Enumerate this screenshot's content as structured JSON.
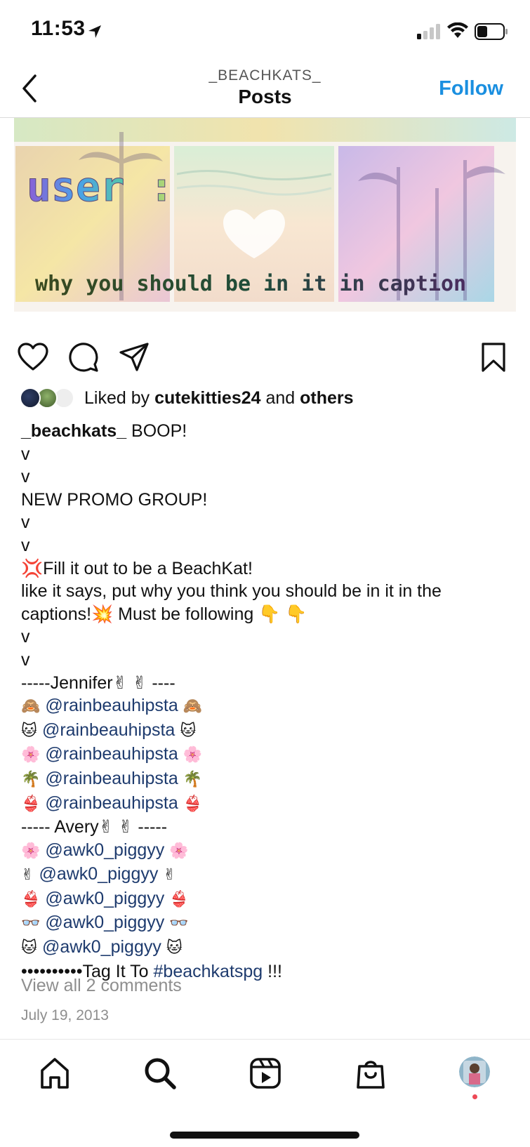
{
  "status_bar": {
    "time": "11:53"
  },
  "header": {
    "username": "_BEACHKATS_",
    "title": "Posts",
    "follow_label": "Follow"
  },
  "post": {
    "image_text": {
      "user_label": "user :",
      "subtitle": "why you should be in it in caption"
    },
    "likes": {
      "prefix": "Liked by ",
      "user": "cutekitties24",
      "middle": " and ",
      "others": "others"
    },
    "caption": {
      "username": "_beachkats_",
      "first_text": " BOOP!",
      "lines": [
        "v",
        "v",
        "NEW PROMO GROUP!",
        "v",
        "v",
        "💢Fill it out to be a BeachKat!",
        "like it says, put why you think you should be in it in the",
        "captions!💥 Must be following  👇 👇",
        "v",
        "v",
        "-----Jennifer✌ ✌ ----"
      ],
      "jennifer_rows": [
        {
          "pre": "🙈 ",
          "mention": "@rainbeauhipsta",
          "post": " 🙈"
        },
        {
          "pre": "🐱 ",
          "mention": "@rainbeauhipsta",
          "post": " 🐱"
        },
        {
          "pre": "🌸 ",
          "mention": "@rainbeauhipsta",
          "post": " 🌸"
        },
        {
          "pre": "🌴 ",
          "mention": "@rainbeauhipsta",
          "post": " 🌴"
        },
        {
          "pre": "👙 ",
          "mention": "@rainbeauhipsta",
          "post": " 👙"
        }
      ],
      "avery_header": "----- Avery✌ ✌ -----",
      "avery_rows": [
        {
          "pre": "🌸 ",
          "mention": "@awk0_piggyy",
          "post": " 🌸"
        },
        {
          "pre": "✌ ",
          "mention": "@awk0_piggyy",
          "post": " ✌"
        },
        {
          "pre": "👙 ",
          "mention": "@awk0_piggyy",
          "post": " 👙"
        },
        {
          "pre": "👓 ",
          "mention": "@awk0_piggyy",
          "post": " 👓"
        },
        {
          "pre": "🐱 ",
          "mention": "@awk0_piggyy",
          "post": " 🐱"
        }
      ],
      "tag_prefix": "••••••••••Tag It To ",
      "hashtag": "#beachkatspg",
      "tag_suffix": " !!!"
    },
    "view_comments": "View all 2 comments",
    "date": "July 19, 2013"
  },
  "colors": {
    "accent": "#1a8fe0",
    "mention": "#1e3b6e",
    "muted": "#8e8e8e",
    "notification_dot": "#ed4956"
  },
  "icons": {
    "header": [
      "back-chevron-icon"
    ],
    "actions": [
      "heart-icon",
      "comment-icon",
      "share-icon",
      "bookmark-icon"
    ],
    "nav": [
      "home-icon",
      "search-icon",
      "reels-icon",
      "shop-icon",
      "profile-avatar"
    ]
  }
}
